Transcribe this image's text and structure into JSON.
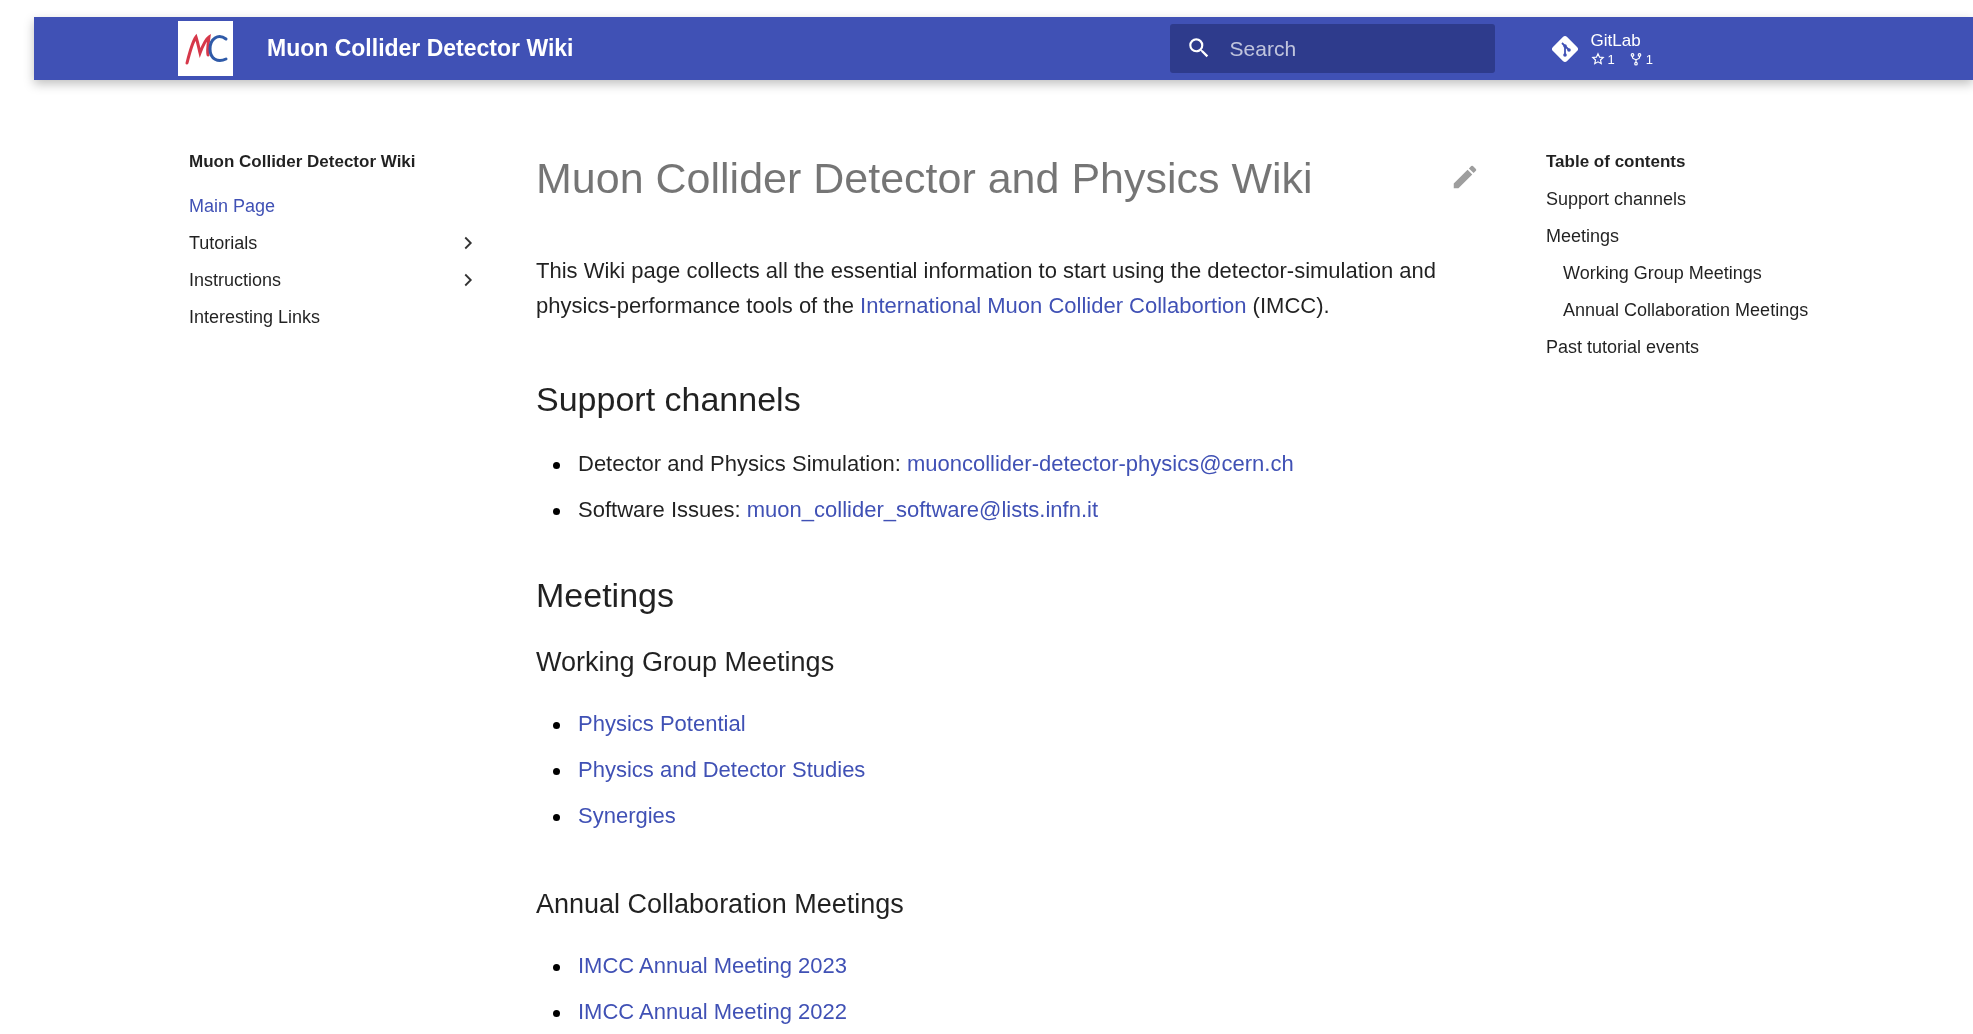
{
  "header": {
    "title": "Muon Collider Detector Wiki",
    "search": {
      "placeholder": "Search"
    },
    "repo": {
      "name": "GitLab",
      "stars": "1",
      "forks": "1"
    }
  },
  "nav": {
    "title": "Muon Collider Detector Wiki",
    "items": [
      {
        "label": "Main Page",
        "selected": true,
        "expandable": false
      },
      {
        "label": "Tutorials",
        "selected": false,
        "expandable": true
      },
      {
        "label": "Instructions",
        "selected": false,
        "expandable": true
      },
      {
        "label": "Interesting Links",
        "selected": false,
        "expandable": false
      }
    ]
  },
  "page": {
    "title": "Muon Collider Detector and Physics Wiki",
    "intro": {
      "before": "This Wiki page collects all the essential information to start using the detector-simulation and physics-performance tools of the ",
      "link": "International Muon Collider Collabortion",
      "after": " (IMCC)."
    },
    "sections": [
      {
        "title": "Support channels",
        "items": [
          {
            "label": "Detector and Physics Simulation: ",
            "link": "muoncollider-detector-physics@cern.ch"
          },
          {
            "label": "Software Issues: ",
            "link": "muon_collider_software@lists.infn.it"
          }
        ]
      },
      {
        "title": "Meetings",
        "subsections": [
          {
            "title": "Working Group Meetings",
            "items": [
              {
                "link": "Physics Potential"
              },
              {
                "link": "Physics and Detector Studies"
              },
              {
                "link": "Synergies"
              }
            ]
          },
          {
            "title": "Annual Collaboration Meetings",
            "items": [
              {
                "link": "IMCC Annual Meeting 2023"
              },
              {
                "link": "IMCC Annual Meeting 2022"
              }
            ]
          }
        ]
      }
    ]
  },
  "toc": {
    "title": "Table of contents",
    "items": [
      {
        "label": "Support channels"
      },
      {
        "label": "Meetings",
        "children": [
          {
            "label": "Working Group Meetings"
          },
          {
            "label": "Annual Collaboration Meetings"
          }
        ]
      },
      {
        "label": "Past tutorial events"
      }
    ]
  }
}
